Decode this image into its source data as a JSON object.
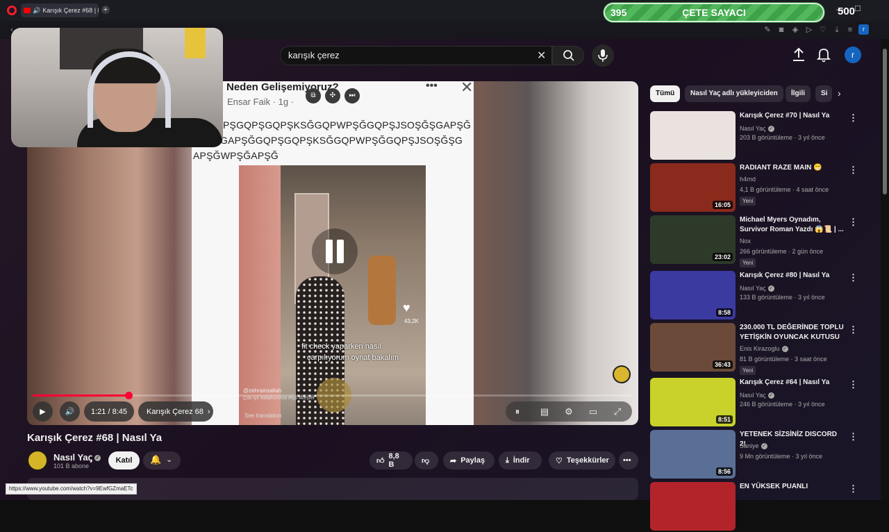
{
  "browser": {
    "tab_title": "Karışık Çerez #68 | Na",
    "new_tab_symbol": "+",
    "minimize_symbol": "—",
    "maximize_symbol": "☐",
    "profile_initial": "r"
  },
  "overlay": {
    "counter_value": "395",
    "counter_label": "ÇETE SAYACI",
    "counter_goal": "500"
  },
  "header": {
    "search_value": "karışık çerez",
    "avatar_initial": "r"
  },
  "player_content": {
    "post_title": "Neden Gelişemiyoruz?",
    "post_author": "Ensar Faik · 1g ·",
    "text_line1": "PŞGQPŞGQPŞKSĞGQPWPŞĞGQPŞJSOŞĞŞGAPŞĞ",
    "text_line2": "GAPŞĞGQPŞGQPŞKSĞGQPWPŞĞGQPŞJSOŞĞŞG",
    "text_line3": "APŞĞWPŞĞAPŞĞ",
    "inner_caption1": "fit check yaparken nasıl",
    "inner_caption2": "çarpılıyorum oynat bakalım",
    "inner_likes": "43,2K",
    "inner_handle": "@zehrainsallah",
    "inner_tags": "Çok iyi! #allahumma #fyp #keşfet",
    "inner_translate": "See translation"
  },
  "controls": {
    "time": "1:21 / 8:45",
    "chapter": "Karışık Çerez 68",
    "progress": 0.16
  },
  "video": {
    "title": "Karışık Çerez #68 | Nasıl Ya",
    "channel": "Nasıl Yaꞔ",
    "subscribers": "101 B abone",
    "join": "Katıl",
    "likes": "8,8 B",
    "share": "Paylaş",
    "download": "İndir",
    "thanks": "Teşekkürler"
  },
  "status_url": "https://www.youtube.com/watch?v=9EwfGZmaETc",
  "chips": [
    "Tümü",
    "Nasıl Yaꞔ adlı yükleyiciden",
    "İlgili",
    "Si"
  ],
  "recommendations": [
    {
      "title": "Karışık Çerez #70 | Nasıl Ya",
      "channel": "Nasıl Yaꞔ",
      "verified": true,
      "meta": "203 B görüntüleme · 3 yıl önce",
      "duration": "",
      "badge": "",
      "thumb": "#e9e2de"
    },
    {
      "title": "RADIANT RAZE MAIN 😁",
      "channel": "h4rnd",
      "verified": false,
      "meta": "4,1 B görüntüleme · 4 saat önce",
      "duration": "16:05",
      "badge": "Yeni",
      "thumb": "#8a2a1c"
    },
    {
      "title": "Michael Myers Oynadım, Survivor Roman Yazdı 😱📜 | ...",
      "channel": "Nox",
      "verified": false,
      "meta": "266 görüntüleme · 2 gün önce",
      "duration": "23:02",
      "badge": "Yeni",
      "thumb": "#2d3a2a"
    },
    {
      "title": "Karışık Çerez #80 | Nasıl Ya",
      "channel": "Nasıl Yaꞔ",
      "verified": true,
      "meta": "133 B görüntüleme · 3 yıl önce",
      "duration": "8:58",
      "badge": "",
      "thumb": "#3b3aa0"
    },
    {
      "title": "230.000 TL DEĞERİNDE TOPLU YETİŞKİN OYUNCAK KUTUSU ...",
      "channel": "Enis Kirazoglu",
      "verified": true,
      "meta": "81 B görüntüleme · 3 saat önce",
      "duration": "36:43",
      "badge": "Yeni",
      "thumb": "#6b4a3a"
    },
    {
      "title": "Karışık Çerez #64 | Nasıl Ya",
      "channel": "Nasıl Yaꞔ",
      "verified": true,
      "meta": "246 B görüntüleme · 3 yıl önce",
      "duration": "8:51",
      "badge": "",
      "thumb": "#c8d22a"
    },
    {
      "title": "YETENEK SİZSİNİZ DISCORD 2!",
      "channel": "Saniye",
      "verified": true,
      "meta": "9 Mn görüntüleme · 3 yıl önce",
      "duration": "8:56",
      "badge": "",
      "thumb": "#5a6f95"
    },
    {
      "title": "EN YÜKSEK PUANLI",
      "channel": "",
      "verified": false,
      "meta": "",
      "duration": "",
      "badge": "",
      "thumb": "#b3242a"
    }
  ]
}
